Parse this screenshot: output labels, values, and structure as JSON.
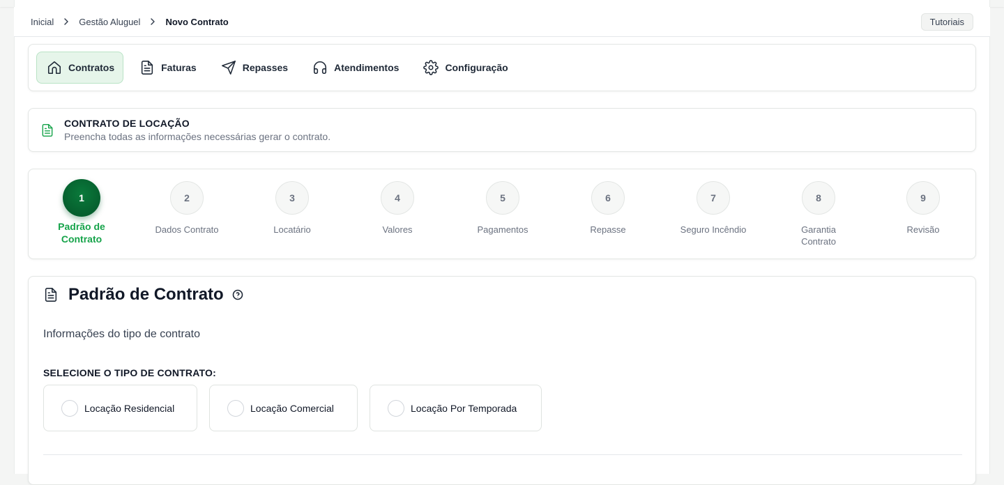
{
  "breadcrumb": {
    "items": [
      "Inicial",
      "Gestão Aluguel",
      "Novo Contrato"
    ]
  },
  "tutorials_label": "Tutoriais",
  "nav": {
    "items": [
      {
        "label": "Contratos",
        "icon": "home-icon",
        "active": true
      },
      {
        "label": "Faturas",
        "icon": "document-icon"
      },
      {
        "label": "Repasses",
        "icon": "send-icon"
      },
      {
        "label": "Atendimentos",
        "icon": "headphones-icon"
      },
      {
        "label": "Configuração",
        "icon": "gear-icon"
      }
    ]
  },
  "info": {
    "title": "CONTRATO DE LOCAÇÃO",
    "subtitle": "Preencha todas as informações necessárias gerar o contrato."
  },
  "steps": [
    {
      "number": "1",
      "label": "Padrão de Contrato",
      "active": true
    },
    {
      "number": "2",
      "label": "Dados Contrato"
    },
    {
      "number": "3",
      "label": "Locatário"
    },
    {
      "number": "4",
      "label": "Valores"
    },
    {
      "number": "5",
      "label": "Pagamentos"
    },
    {
      "number": "6",
      "label": "Repasse"
    },
    {
      "number": "7",
      "label": "Seguro Incêndio"
    },
    {
      "number": "8",
      "label": "Garantia Contrato"
    },
    {
      "number": "9",
      "label": "Revisão"
    }
  ],
  "section": {
    "title": "Padrão de Contrato",
    "subtitle": "Informações do tipo de contrato",
    "select_label": "SELECIONE O TIPO DE CONTRATO:",
    "options": [
      "Locação Residencial",
      "Locação Comercial",
      "Locação Por Temporada"
    ]
  },
  "colors": {
    "accent": "#16a34a",
    "active_step": "#065f2e",
    "active_nav_bg": "#e6f5ea"
  }
}
